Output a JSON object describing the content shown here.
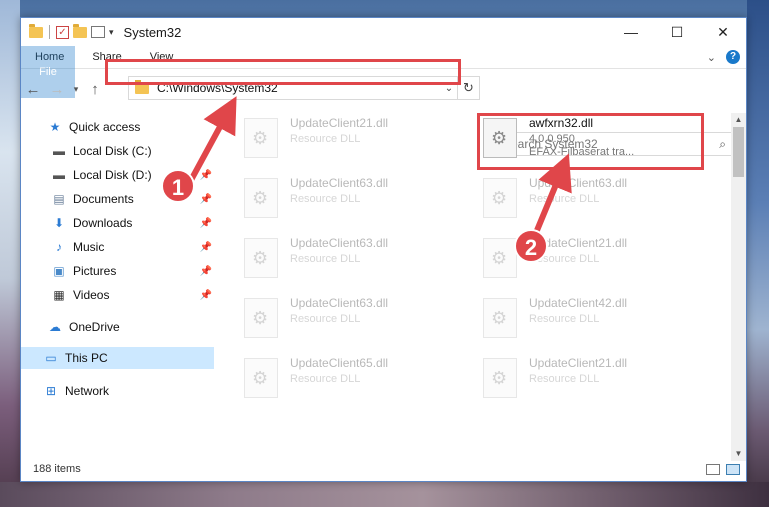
{
  "window": {
    "title": "System32",
    "controls": {
      "minimize": "—",
      "maximize": "☐",
      "close": "✕"
    }
  },
  "ribbon": {
    "tabs": [
      "File",
      "Home",
      "Share",
      "View"
    ]
  },
  "address": {
    "path": "C:\\Windows\\System32",
    "search_placeholder": "Search System32"
  },
  "sidebar": {
    "items": [
      {
        "label": "Quick access",
        "icon": "star-icon"
      },
      {
        "label": "Local Disk (C:)",
        "icon": "drive-icon"
      },
      {
        "label": "Local Disk (D:)",
        "icon": "drive-icon"
      },
      {
        "label": "Documents",
        "icon": "documents-icon"
      },
      {
        "label": "Downloads",
        "icon": "download-icon"
      },
      {
        "label": "Music",
        "icon": "music-icon"
      },
      {
        "label": "Pictures",
        "icon": "pictures-icon"
      },
      {
        "label": "Videos",
        "icon": "videos-icon"
      },
      {
        "label": "OneDrive",
        "icon": "cloud-icon"
      },
      {
        "label": "This PC",
        "icon": "computer-icon"
      },
      {
        "label": "Network",
        "icon": "network-icon"
      }
    ]
  },
  "files": [
    {
      "name": "UpdateClient21.dll",
      "sub": "Resource DLL"
    },
    {
      "name": "awfxrn32.dll",
      "sub": "4.0.0.950",
      "sub2": "EFAX-Filbaserat tra..."
    },
    {
      "name": "UpdateClient63.dll",
      "sub": "Resource DLL"
    },
    {
      "name": "UpdateClient63.dll",
      "sub": "Resource DLL"
    },
    {
      "name": "UpdateClient63.dll",
      "sub": "Resource DLL"
    },
    {
      "name": "UpdateClient21.dll",
      "sub": "Resource DLL"
    },
    {
      "name": "UpdateClient63.dll",
      "sub": "Resource DLL"
    },
    {
      "name": "UpdateClient42.dll",
      "sub": "Resource DLL"
    },
    {
      "name": "UpdateClient65.dll",
      "sub": "Resource DLL"
    },
    {
      "name": "UpdateClient21.dll",
      "sub": "Resource DLL"
    }
  ],
  "status": {
    "item_count": "188 items"
  },
  "callouts": [
    "1",
    "2"
  ],
  "colors": {
    "highlight": "#e0464a",
    "accent": "#1979ca",
    "selected": "#cce8ff"
  }
}
